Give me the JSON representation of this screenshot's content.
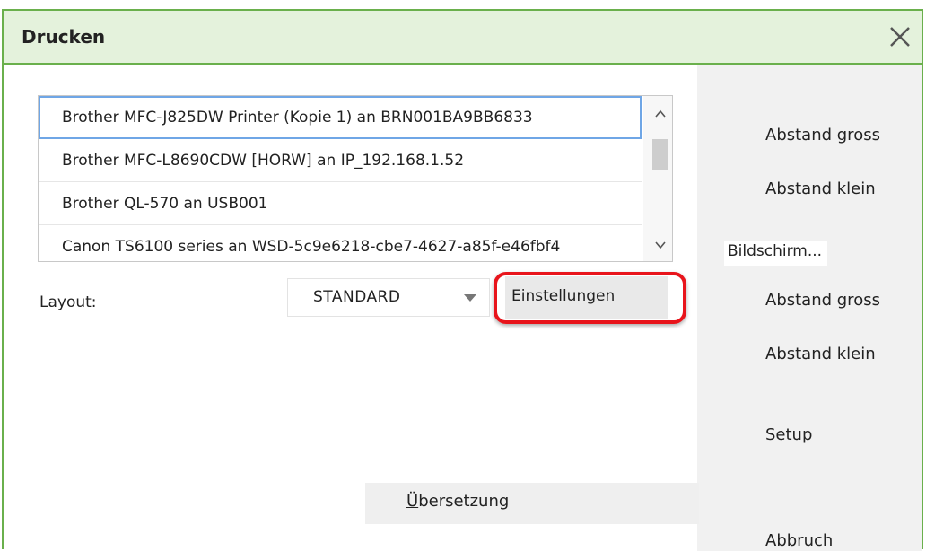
{
  "dialog": {
    "title": "Drucken",
    "close_icon": "close-icon"
  },
  "printers": {
    "items": [
      "Brother MFC-J825DW Printer (Kopie 1) an BRN001BA9BB6833",
      "Brother MFC-L8690CDW [HORW] an IP_192.168.1.52",
      "Brother QL-570 an USB001",
      "Canon TS6100 series an WSD-5c9e6218-cbe7-4627-a85f-e46fbf4"
    ],
    "selected_index": 0
  },
  "layout": {
    "label": "Layout:",
    "selected": "STANDARD"
  },
  "settings_button": {
    "label_pre": "Ein",
    "label_ul": "s",
    "label_post": "tellungen"
  },
  "translation_button": {
    "label_ul": "Ü",
    "label_post": "bersetzung"
  },
  "right_panel": {
    "printer_gap_large": "Abstand gross",
    "printer_gap_small": "Abstand klein",
    "screen_label": "Bildschirm...",
    "screen_gap_large": "Abstand gross",
    "screen_gap_small": "Abstand klein",
    "setup": "Setup",
    "cancel_ul": "A",
    "cancel_post": "bbruch"
  },
  "colors": {
    "accent_green": "#6ab04c",
    "title_bg": "#e4f2dc",
    "highlight_red": "#e8141b",
    "selection_blue": "#6fa6e6"
  }
}
